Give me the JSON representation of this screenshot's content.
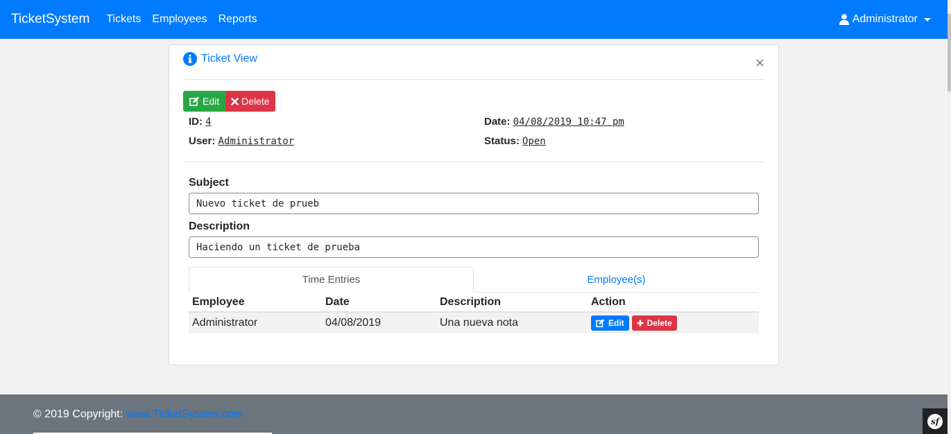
{
  "navbar": {
    "brand": "TicketSystem",
    "links": [
      "Tickets",
      "Employees",
      "Reports"
    ],
    "user": "Administrator"
  },
  "card": {
    "title": "Ticket View",
    "close": "×",
    "buttons": {
      "edit": "Edit",
      "delete": "Delete"
    },
    "meta": {
      "id_label": "ID:",
      "id_value": "4",
      "user_label": "User:",
      "user_value": "Administrator",
      "date_label": "Date:",
      "date_value": "04/08/2019 10:47 pm",
      "status_label": "Status:",
      "status_value": "Open"
    },
    "subject": {
      "label": "Subject",
      "value": "Nuevo ticket de prueb"
    },
    "description": {
      "label": "Description",
      "value": "Haciendo un ticket de prueba"
    },
    "tabs": [
      "Time Entries",
      "Employee(s)"
    ],
    "table": {
      "headers": [
        "Employee",
        "Date",
        "Description",
        "Action"
      ],
      "rows": [
        {
          "employee": "Administrator",
          "date": "04/08/2019",
          "description": "Una nueva nota",
          "edit": "Edit",
          "delete": "Delete"
        }
      ]
    }
  },
  "footer": {
    "copyright": "© 2019 Copyright:",
    "link": "www.TicketSystem.com",
    "badge": "sf"
  },
  "colors": {
    "primary": "#007bff",
    "success": "#28a745",
    "danger": "#dc3545",
    "footer_bg": "#6c757d"
  }
}
